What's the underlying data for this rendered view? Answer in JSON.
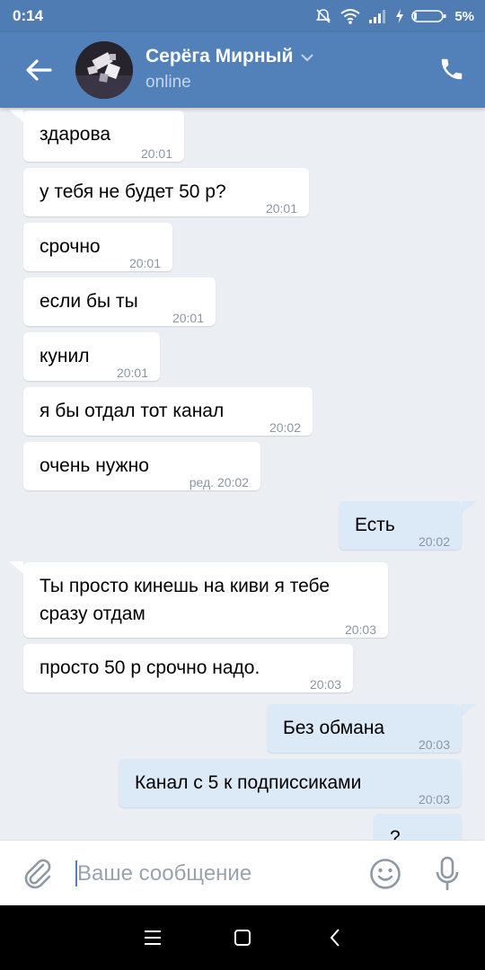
{
  "status_bar": {
    "time": "0:14",
    "battery": "5%"
  },
  "header": {
    "contact_name": "Серёга Мирный",
    "contact_status": "online"
  },
  "messages": [
    {
      "dir": "in",
      "text": "здарова",
      "time": "20:01"
    },
    {
      "dir": "in",
      "text": "у тебя не будет 50 р?",
      "time": "20:01"
    },
    {
      "dir": "in",
      "text": "срочно",
      "time": "20:01"
    },
    {
      "dir": "in",
      "text": "если бы ты",
      "time": "20:01"
    },
    {
      "dir": "in",
      "text": "кунил",
      "time": "20:01"
    },
    {
      "dir": "in",
      "text": "я бы отдал тот канал",
      "time": "20:02"
    },
    {
      "dir": "in",
      "text": "очень нужно",
      "time": "ред. 20:02"
    },
    {
      "dir": "out",
      "text": "Есть",
      "time": "20:02"
    },
    {
      "dir": "in",
      "lines": [
        "Ты просто кинешь на киви я тебе",
        "сразу отдам"
      ],
      "time": "20:03"
    },
    {
      "dir": "in",
      "text": "просто 50 р срочно надо.",
      "time": "20:03"
    },
    {
      "dir": "out",
      "text": "Без обмана",
      "time": "20:03"
    },
    {
      "dir": "out",
      "text": "Канал с 5 к подписсиками",
      "time": "20:03"
    },
    {
      "dir": "out",
      "text": "?",
      "time": ""
    }
  ],
  "composer": {
    "placeholder": "Ваше сообщение"
  },
  "icons": {
    "back": "arrow-left-icon",
    "call": "phone-icon",
    "attach": "paperclip-icon",
    "emoji": "smiley-icon",
    "mic": "microphone-icon",
    "nav_menu": "menu-icon",
    "nav_home": "square-icon",
    "nav_back": "chevron-left-icon"
  },
  "colors": {
    "header": "#5181b8",
    "status_bar": "#4f7db3",
    "chat_bg": "#ebeef2",
    "incoming": "#ffffff",
    "outgoing": "#dce9f7",
    "time": "#8a96a3"
  }
}
